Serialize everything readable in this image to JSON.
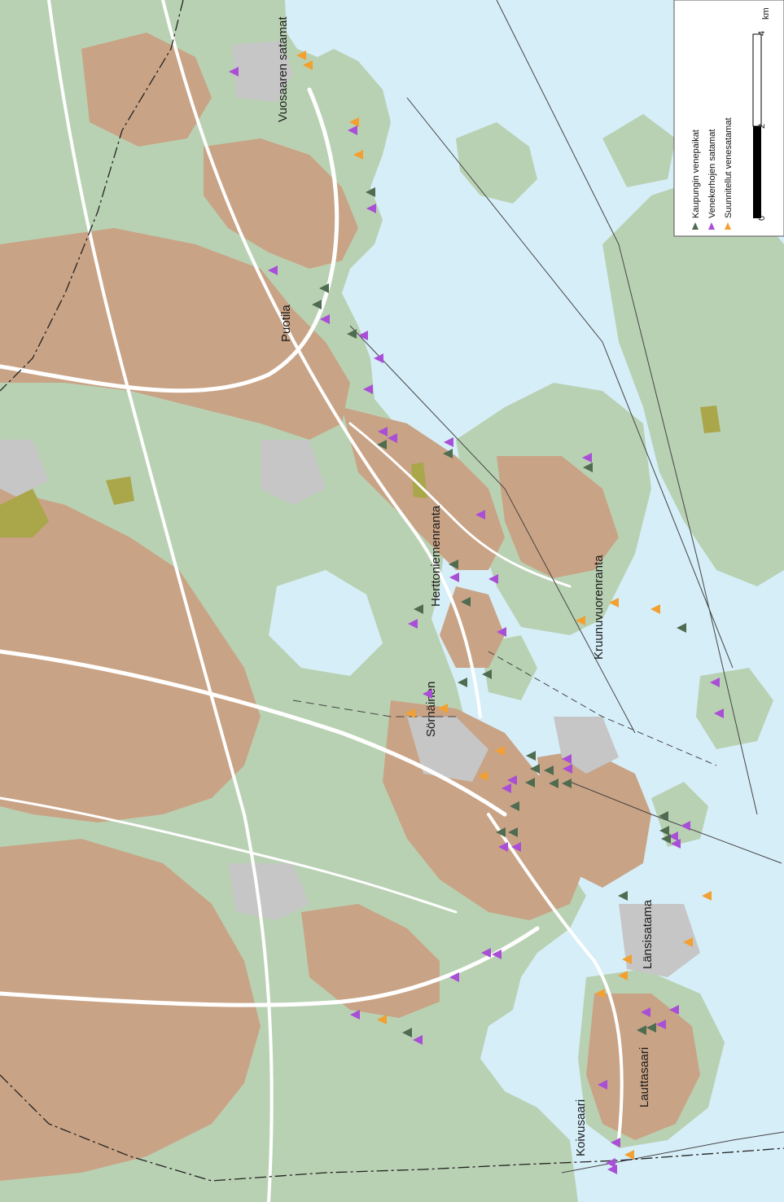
{
  "map": {
    "colors": {
      "water": "#d6eef8",
      "green": "#b9d1b3",
      "urban": "#c9a385",
      "industrial": "#c6c6c6",
      "road": "#ffffff",
      "wetland": "#aaa64a",
      "marker_city": "#4f6b50",
      "marker_club": "#a94ed6",
      "marker_planned": "#f2a030"
    },
    "labels": [
      {
        "id": "vuosaaren",
        "text": "Vuosaaren satamat"
      },
      {
        "id": "puotila",
        "text": "Puotila"
      },
      {
        "id": "herttoniemenranta",
        "text": "Herttoniemenranta"
      },
      {
        "id": "kruunuvuorenranta",
        "text": "Kruunuvuorenranta"
      },
      {
        "id": "sornainen",
        "text": "Sörnäinen"
      },
      {
        "id": "lansisatama",
        "text": "Länsisatama"
      },
      {
        "id": "lauttasaari",
        "text": "Lauttasaari"
      },
      {
        "id": "koivusaari",
        "text": "Koivusaari"
      }
    ],
    "legend": {
      "items": [
        {
          "label": "Kaupungin venepaikat",
          "kind": "city"
        },
        {
          "label": "Venekerhojen satamat",
          "kind": "club"
        },
        {
          "label": "Suunnitellut venesatamat",
          "kind": "planned"
        }
      ]
    },
    "scale": {
      "unit": "km",
      "ticks": [
        "0",
        "2",
        "4"
      ]
    }
  }
}
